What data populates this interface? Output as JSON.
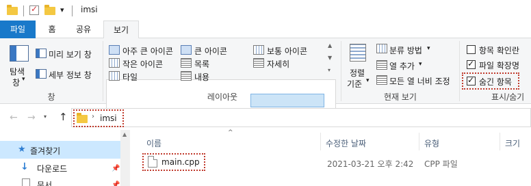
{
  "window": {
    "title": "imsi"
  },
  "tabs": [
    "파일",
    "홈",
    "공유",
    "보기"
  ],
  "ribbon": {
    "panes": {
      "nav_pane_label1": "탐색",
      "nav_pane_label2": "창",
      "preview_pane": "미리 보기 창",
      "details_pane": "세부 정보 창",
      "group_label": "창"
    },
    "layout": {
      "extra_large_icons": "아주 큰 아이콘",
      "large_icons": "큰 아이콘",
      "medium_icons": "보통 아이콘",
      "small_icons": "작은 아이콘",
      "list": "목록",
      "details": "자세히",
      "tiles": "타일",
      "content": "내용",
      "group_label": "레이아웃"
    },
    "current_view": {
      "sort_by_label1": "정렬",
      "sort_by_label2": "기준",
      "group_by": "분류 방법",
      "add_columns": "열 추가",
      "size_all_columns": "모든 열 너비 조정",
      "group_label": "현재 보기"
    },
    "show_hide": {
      "item_check_boxes": "항목 확인란",
      "item_check_boxes_checked": false,
      "file_name_extensions": "파일 확장명",
      "file_name_extensions_checked": true,
      "hidden_items": "숨긴 항목",
      "hidden_items_checked": true,
      "group_label": "표시/숨기"
    }
  },
  "address": {
    "breadcrumb": "imsi"
  },
  "columns": [
    "이름",
    "수정한 날짜",
    "유형",
    "크기"
  ],
  "nav": {
    "quick_access": "즐겨찾기",
    "downloads": "다운로드",
    "documents": "문서"
  },
  "files": [
    {
      "name": "main.cpp",
      "modified": "2021-03-21 오후 2:42",
      "type": "CPP 파일",
      "size": ""
    }
  ]
}
